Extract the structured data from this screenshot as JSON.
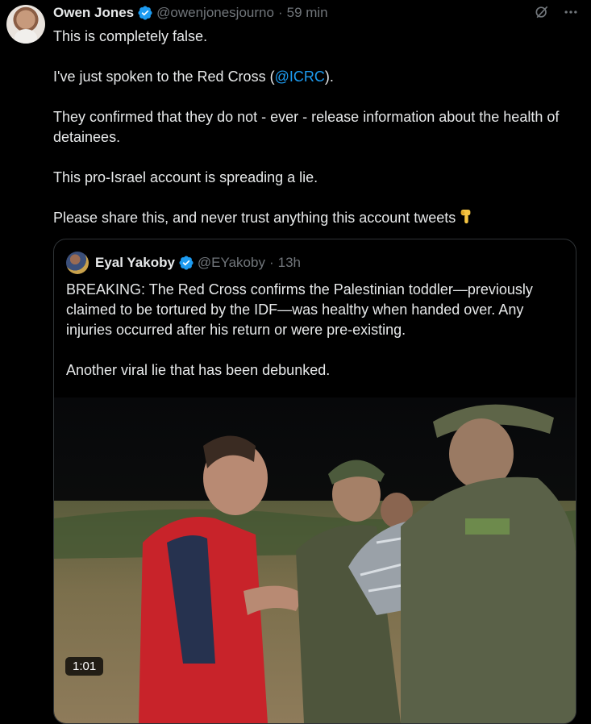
{
  "tweet": {
    "name": "Owen Jones",
    "handle": "@owenjonesjourno",
    "separator": "·",
    "time": "59 min",
    "text": {
      "line1": "This is completely false.",
      "line2_before": "I've just spoken to the Red Cross (",
      "line2_mention": "@ICRC",
      "line2_after": ").",
      "line3": "They confirmed that they do not - ever - release information about the health of detainees.",
      "line4": "This pro-Israel account is spreading a lie.",
      "line5": "Please share this, and never trust anything this account tweets"
    },
    "icons": {
      "grok": "grok-icon",
      "more": "more-icon",
      "emoji": "pointing-down-emoji"
    }
  },
  "quote": {
    "name": "Eyal Yakoby",
    "handle": "@EYakoby",
    "separator": "·",
    "time": "13h",
    "text": {
      "p1": "BREAKING: The Red Cross confirms the Palestinian toddler—previously claimed to be tortured by the IDF—was healthy when handed over. Any injuries occurred after his return or were pre-existing.",
      "p2": "Another viral lie that has been debunked."
    },
    "video": {
      "duration": "1:01"
    }
  },
  "colors": {
    "background": "#000000",
    "text": "#e7e9ea",
    "secondary": "#71767b",
    "link": "#1d9bf0",
    "verified": "#1d9bf0",
    "border": "#2f3336"
  }
}
